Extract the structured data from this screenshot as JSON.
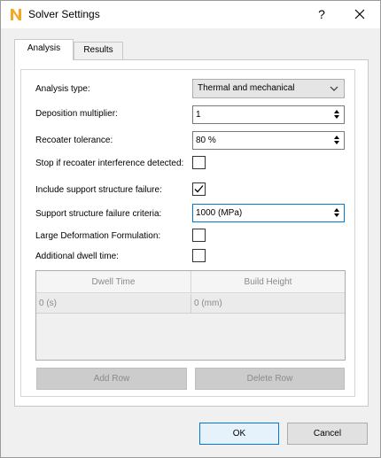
{
  "window": {
    "title": "Solver Settings",
    "help": "?"
  },
  "tabs": [
    {
      "label": "Analysis",
      "active": true
    },
    {
      "label": "Results",
      "active": false
    }
  ],
  "form": {
    "analysis_type": {
      "label": "Analysis type:",
      "value": "Thermal and mechanical"
    },
    "deposition_multiplier": {
      "label": "Deposition multiplier:",
      "value": "1"
    },
    "recoater_tolerance": {
      "label": "Recoater tolerance:",
      "value": "80 %"
    },
    "stop_recoater": {
      "label": "Stop if recoater interference detected:",
      "checked": false
    },
    "include_support": {
      "label": "Include support structure failure:",
      "checked": true
    },
    "support_criteria": {
      "label": "Support structure failure criteria:",
      "value": "1000 (MPa)"
    },
    "large_deformation": {
      "label": "Large Deformation Formulation:",
      "checked": false
    },
    "additional_dwell": {
      "label": "Additional dwell time:",
      "checked": false
    }
  },
  "dwell_table": {
    "columns": [
      "Dwell Time",
      "Build Height"
    ],
    "rows": [
      [
        "0 (s)",
        "0 (mm)"
      ]
    ]
  },
  "buttons": {
    "add_row": "Add Row",
    "delete_row": "Delete Row",
    "ok": "OK",
    "cancel": "Cancel"
  },
  "colors": {
    "accent": "#0078d7",
    "app_icon": "#f5a623"
  }
}
